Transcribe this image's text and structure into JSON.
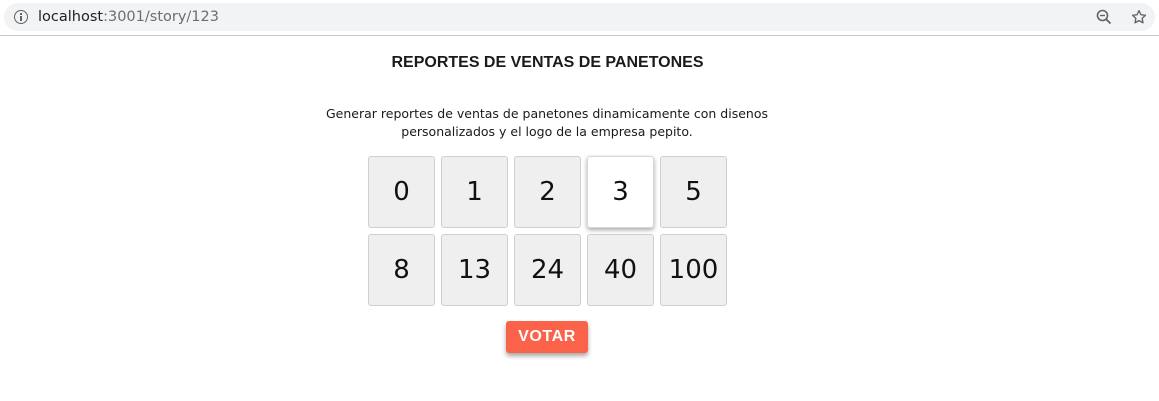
{
  "browser": {
    "url_host": "localhost",
    "url_path": ":3001/story/123"
  },
  "page": {
    "title": "REPORTES DE VENTAS DE PANETONES",
    "description_line1": "Generar reportes de ventas de panetones dinamicamente con disenos",
    "description_line2": "personalizados y el logo de la empresa pepito."
  },
  "cards": {
    "values": [
      "0",
      "1",
      "2",
      "3",
      "5",
      "8",
      "13",
      "24",
      "40",
      "100"
    ],
    "selected": "3"
  },
  "vote_button": {
    "label": "VOTAR",
    "color": "#fa634a"
  }
}
